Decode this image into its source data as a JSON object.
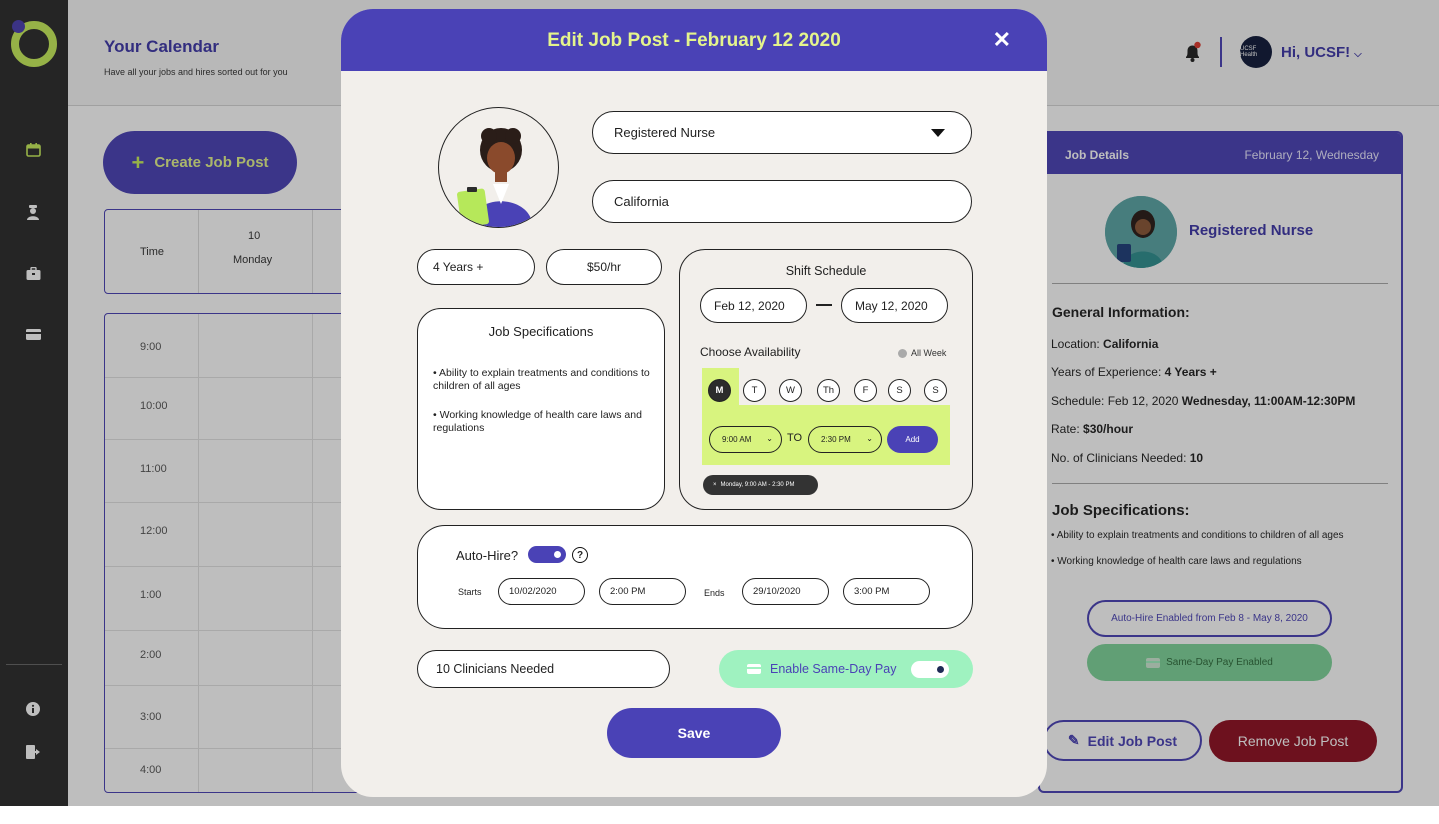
{
  "sidebar": {
    "items": [
      {
        "icon": "calendar-icon",
        "active": true
      },
      {
        "icon": "user-nurse-icon"
      },
      {
        "icon": "briefcase-icon"
      },
      {
        "icon": "credit-card-icon"
      }
    ],
    "bottom": [
      {
        "icon": "info-icon"
      },
      {
        "icon": "logout-icon"
      }
    ]
  },
  "header": {
    "title": "Your Calendar",
    "subtitle": "Have all your jobs and hires sorted out for you",
    "greeting": "Hi, UCSF!",
    "avatar_text": "UCSF Health"
  },
  "calendar": {
    "create_label": "Create Job Post",
    "time_header": "Time",
    "day_number": "10",
    "day_name": "Monday",
    "times": [
      "9:00",
      "10:00",
      "11:00",
      "12:00",
      "1:00",
      "2:00",
      "3:00",
      "4:00"
    ]
  },
  "details": {
    "header_title": "Job Details",
    "header_date": "February 12, Wednesday",
    "role": "Registered Nurse",
    "general_heading": "General Information:",
    "location_label": "Location:",
    "location_value": "California",
    "experience_label": "Years of Experience:",
    "experience_value": "4 Years +",
    "schedule_label": "Schedule: Feb 12, 2020",
    "schedule_value": "Wednesday, 11:00AM-12:30PM",
    "rate_label": "Rate:",
    "rate_value": "$30/hour",
    "clinicians_label": "No. of Clinicians Needed:",
    "clinicians_value": "10",
    "spec_heading": "Job Specifications:",
    "specs": [
      "• Ability to explain treatments and conditions to children of all ages",
      "• Working knowledge of health care laws and regulations"
    ],
    "auto_hire_pill": "Auto-Hire Enabled from Feb 8 - May 8, 2020",
    "same_day_pill": "Same-Day Pay Enabled",
    "edit_label": "Edit Job Post",
    "remove_label": "Remove Job Post"
  },
  "modal": {
    "title": "Edit Job Post - February 12 2020",
    "close": "✕",
    "role_value": "Registered Nurse",
    "location_value": "California",
    "experience_value": "4 Years +",
    "rate_value": "$50/hr",
    "spec_title": "Job Specifications",
    "specs": [
      "• Ability to explain treatments and conditions to children of all ages",
      "• Working knowledge of health care laws and regulations"
    ],
    "shift": {
      "title": "Shift Schedule",
      "start_date": "Feb 12, 2020",
      "end_date": "May 12, 2020",
      "availability_label": "Choose Availability",
      "all_week_label": "All Week",
      "days": [
        "M",
        "T",
        "W",
        "Th",
        "F",
        "S",
        "S"
      ],
      "selected_day": "M",
      "from_time": "9:00 AM",
      "to_label": "TO",
      "to_time": "2:30 PM",
      "add_label": "Add",
      "chip_close": "×",
      "chip_label": "Monday, 9:00 AM - 2:30 PM"
    },
    "auto_hire": {
      "label": "Auto-Hire?",
      "enabled": true,
      "help": "?",
      "starts_label": "Starts",
      "start_date": "10/02/2020",
      "start_time": "2:00 PM",
      "ends_label": "Ends",
      "end_date": "29/10/2020",
      "end_time": "3:00 PM"
    },
    "clinicians_value": "10 Clinicians Needed",
    "same_day_label": "Enable Same-Day Pay",
    "same_day_enabled": true,
    "save_label": "Save"
  },
  "colors": {
    "primary": "#4a42b6",
    "accent_lime": "#c8ef5a",
    "sidebar": "#2c2c2c",
    "danger": "#8f1022",
    "mint": "#9ff2c0"
  }
}
